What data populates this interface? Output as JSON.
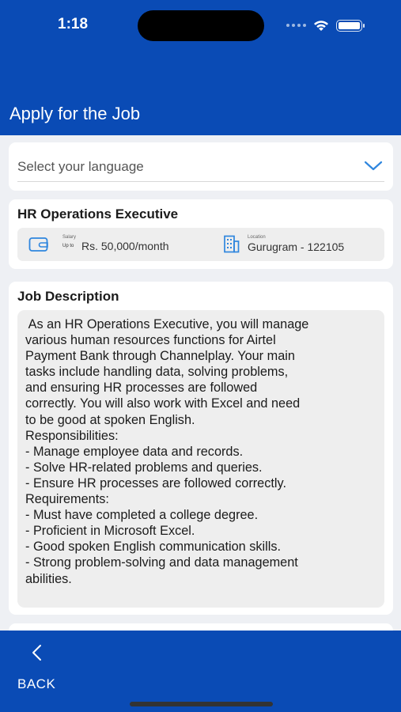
{
  "status_bar": {
    "time": "1:18"
  },
  "header": {
    "title": "Apply for the Job"
  },
  "language_select": {
    "placeholder": "Select your language"
  },
  "job": {
    "title": "HR Operations Executive",
    "salary_caption": "Salary",
    "salary_prefix": "Up to",
    "salary_value": "Rs. 50,000/month",
    "location_caption": "Location",
    "location_value": "Gurugram - 122105"
  },
  "description": {
    "heading": "Job Description",
    "lines": [
      " As an HR Operations Executive, you will manage",
      "various human resources functions for Airtel",
      "Payment Bank through Channelplay. Your main",
      "tasks include handling data, solving problems,",
      "and ensuring HR processes are followed",
      "correctly. You will also work with Excel and need",
      "to be good at spoken English.",
      "Responsibilities:",
      "- Manage employee data and records.",
      "- Solve HR-related problems and queries.",
      "- Ensure HR processes are followed correctly.",
      "Requirements:",
      "- Must have completed a college degree.",
      "- Proficient in Microsoft Excel.",
      "- Good spoken English communication skills.",
      "- Strong problem-solving and data management",
      "abilities."
    ]
  },
  "bottom_nav": {
    "back_label": "BACK"
  },
  "colors": {
    "brand_blue": "#0a4bb5",
    "accent_chevron": "#2f86de"
  },
  "icons": [
    "wifi-icon",
    "battery-icon",
    "chevron-down-icon",
    "wallet-icon",
    "building-icon",
    "back-arrow-icon"
  ]
}
